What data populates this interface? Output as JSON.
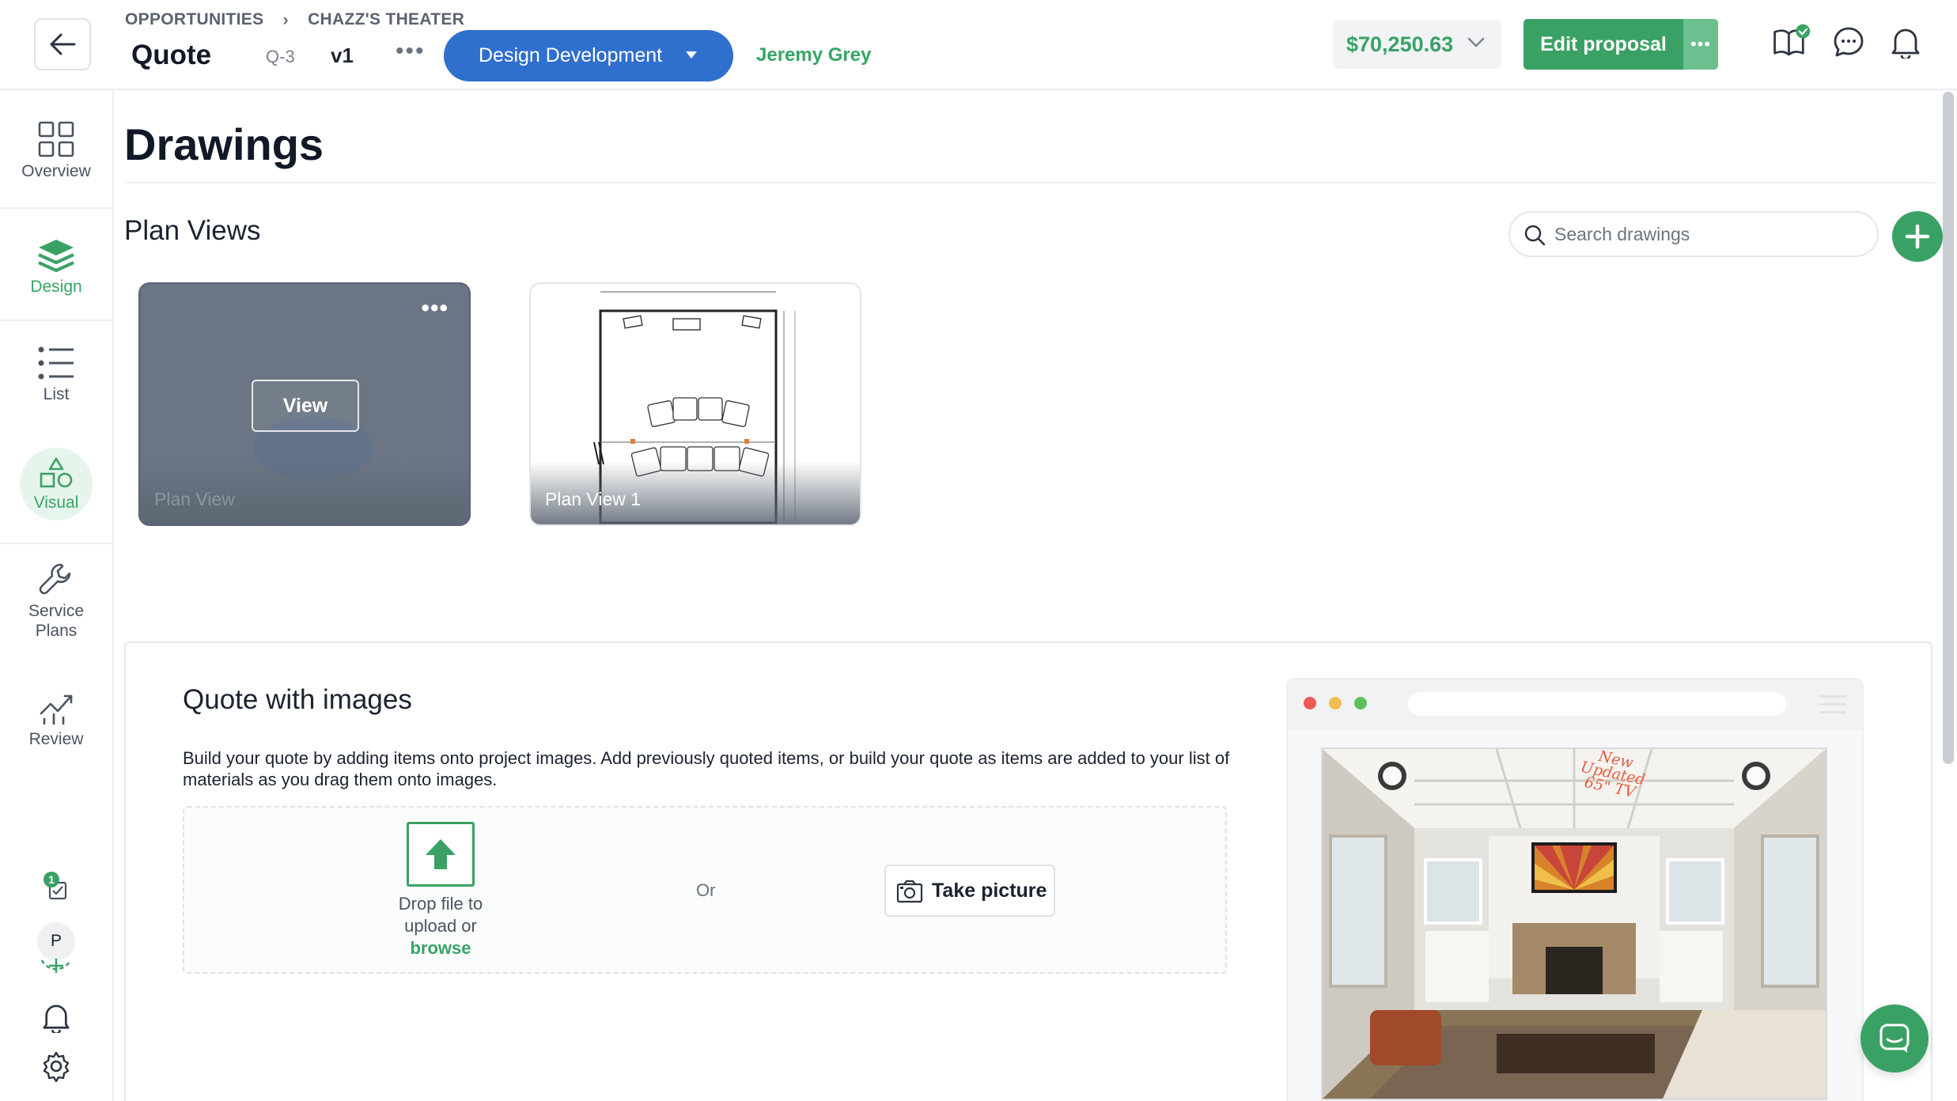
{
  "header": {
    "breadcrumbs": [
      "OPPORTUNITIES",
      "CHAZZ'S THEATER"
    ],
    "title": "Quote",
    "code": "Q-3",
    "version": "v1",
    "stage": "Design Development",
    "owner": "Jeremy Grey",
    "total": "$70,250.63",
    "edit_label": "Edit proposal"
  },
  "sidebar": {
    "items": [
      {
        "label": "Overview",
        "icon": "grid-icon"
      },
      {
        "label": "Design",
        "icon": "layers-icon"
      },
      {
        "label": "List",
        "icon": "list-icon"
      },
      {
        "label": "Visual",
        "icon": "shapes-icon"
      },
      {
        "label": "Service Plans",
        "icon": "wrench-icon"
      },
      {
        "label": "Review",
        "icon": "chart-icon"
      }
    ],
    "task_count": "1",
    "avatar_initial": "P"
  },
  "main": {
    "page_title": "Drawings",
    "section_title": "Plan Views",
    "search_placeholder": "Search drawings",
    "cards": [
      {
        "label": "Plan View",
        "action": "View"
      },
      {
        "label": "Plan View 1"
      }
    ]
  },
  "promo": {
    "title": "Quote with images",
    "description": "Build your quote by adding items onto project images. Add previously quoted items, or build your quote as items are added to your list of materials as you drag them onto images.",
    "drop_text": "Drop file to upload or",
    "browse": "browse",
    "or": "Or",
    "take_picture": "Take picture",
    "room_note": "New Updated 65\" TV"
  },
  "colors": {
    "accent_green": "#3aa165",
    "stage_blue": "#2f6fce"
  }
}
